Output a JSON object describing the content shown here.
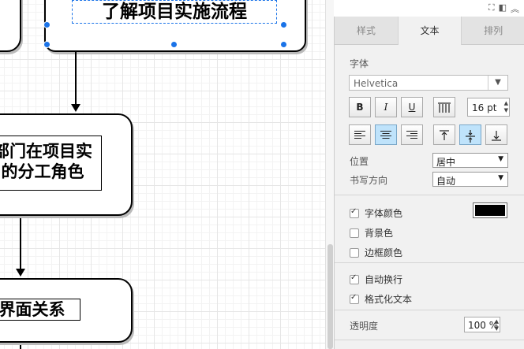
{
  "canvas": {
    "nodes": [
      {
        "text": "了解项目实施流程"
      },
      {
        "line1": "部门在项目实",
        "line2": "的分工角色"
      },
      {
        "text": "界面关系"
      }
    ]
  },
  "topbar": {
    "icons": [
      "fit-icon",
      "format-panel-icon",
      "collapse-icon"
    ]
  },
  "panel": {
    "tabs": [
      {
        "label": "样式",
        "active": false
      },
      {
        "label": "文本",
        "active": true
      },
      {
        "label": "排列",
        "active": false
      }
    ],
    "font_section": "字体",
    "font_family": "Helvetica",
    "bold": "B",
    "italic": "I",
    "underline": "U",
    "font_size": "16 pt",
    "position_label": "位置",
    "position_value": "居中",
    "direction_label": "书写方向",
    "direction_value": "自动",
    "font_color_label": "字体颜色",
    "font_color": "#000000",
    "bg_color_label": "背景色",
    "border_color_label": "边框颜色",
    "wrap_label": "自动换行",
    "formatted_label": "格式化文本",
    "opacity_label": "透明度",
    "opacity_value": "100 %"
  },
  "colors": {
    "accent": "#1a73e8",
    "selected_button": "#bfe3fb"
  }
}
